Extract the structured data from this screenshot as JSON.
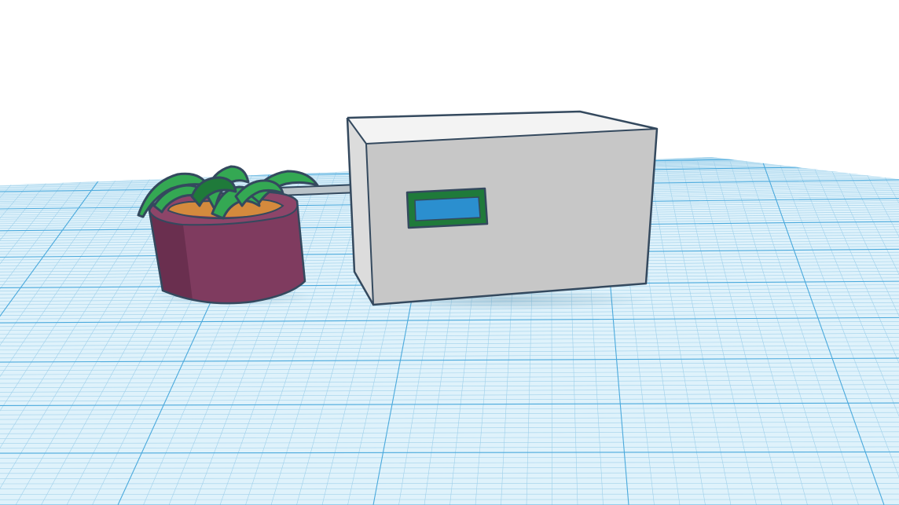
{
  "scene": {
    "view": "3d-perspective",
    "colors": {
      "background": "#ffffff",
      "workplane": "#dff2fb",
      "grid_minor": "#9fd0ea",
      "grid_major": "#4aa9dc",
      "outline": "#34495e",
      "enclosure_front": "#c7c7c7",
      "enclosure_side": "#dcdcdc",
      "enclosure_top": "#f3f3f3",
      "display_bezel": "#1f7a3a",
      "display_screen": "#2b8fcf",
      "pipe": "#b9c3c9",
      "pot_body": "#7f3b5f",
      "pot_dark": "#6a2f4f",
      "pot_rim": "#8d4569",
      "soil": "#d48a3d",
      "leaf": "#34a853",
      "leaf_dark": "#1f7a3a"
    },
    "objects": [
      {
        "name": "grid-workplane",
        "kind": "workplane"
      },
      {
        "name": "enclosure-box",
        "kind": "box"
      },
      {
        "name": "lcd-display",
        "kind": "box"
      },
      {
        "name": "water-pipe",
        "kind": "cylinder"
      },
      {
        "name": "plant-pot",
        "kind": "tube"
      },
      {
        "name": "plant-leaves",
        "kind": "mesh"
      }
    ]
  }
}
